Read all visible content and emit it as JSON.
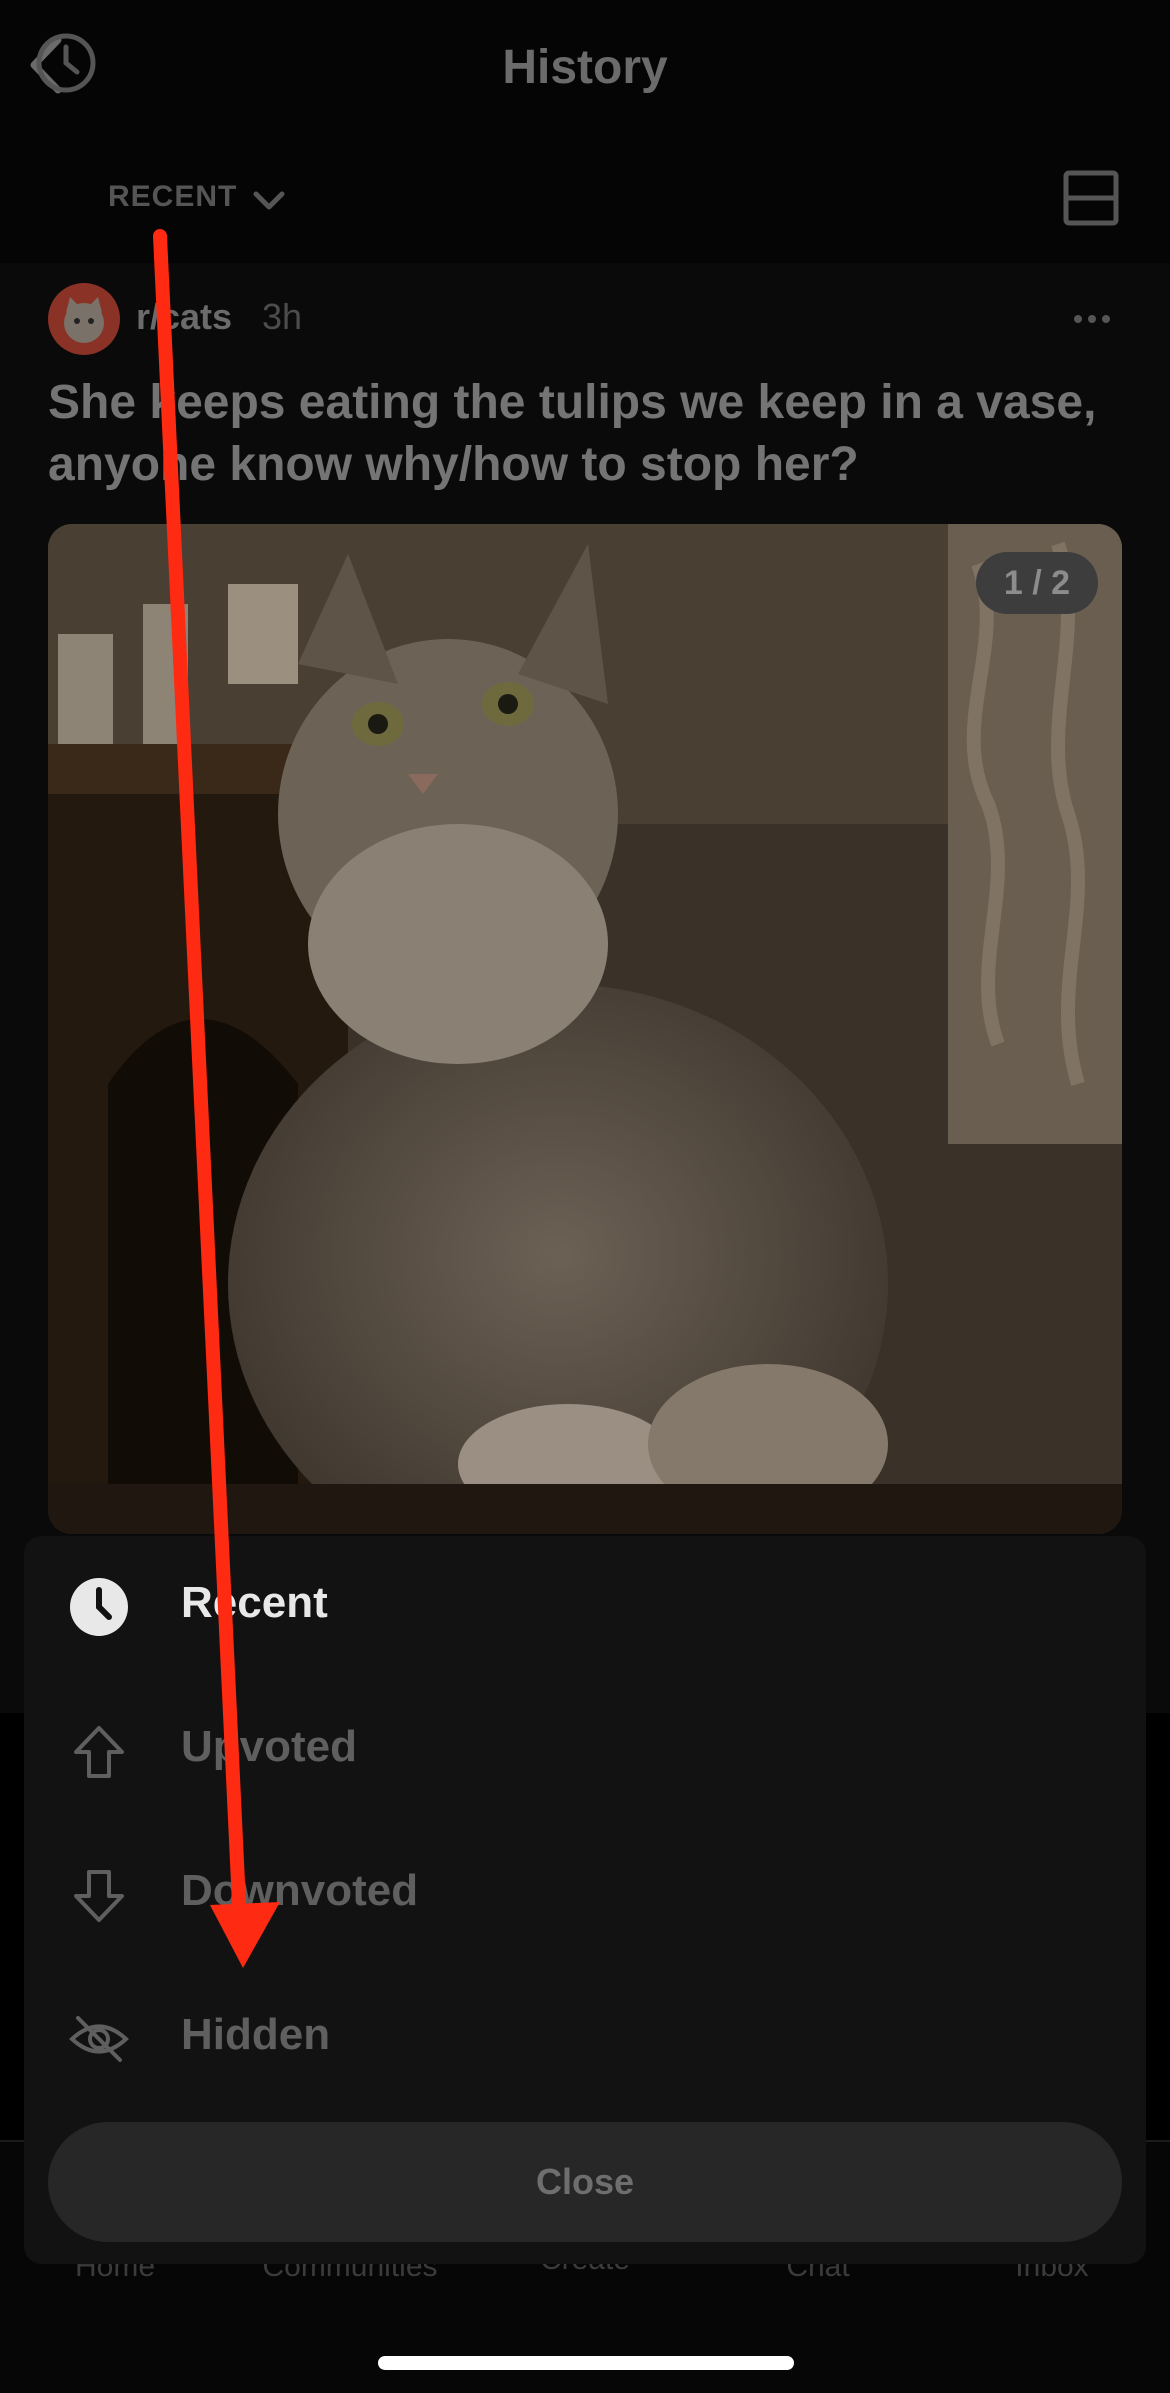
{
  "header": {
    "title": "History",
    "back_icon": "chevron-left-icon"
  },
  "sort_bar": {
    "label": "RECENT",
    "icon": "clock-icon",
    "chevron": "chevron-down-icon",
    "layout_icon": "card-layout-icon"
  },
  "post": {
    "subreddit": "r/cats",
    "age": "3h",
    "title": "She keeps eating the tulips we keep in a vase, anyone know why/how to stop her?",
    "image_counter": "1 / 2",
    "more_icon": "more-horizontal-icon"
  },
  "tabs": [
    {
      "label": "Home"
    },
    {
      "label": "Communities"
    },
    {
      "label": "Create"
    },
    {
      "label": "Chat"
    },
    {
      "label": "Inbox"
    }
  ],
  "sheet": {
    "options": [
      {
        "label": "Recent",
        "icon": "clock-filled-icon",
        "selected": true
      },
      {
        "label": "Upvoted",
        "icon": "upvote-icon",
        "selected": false
      },
      {
        "label": "Downvoted",
        "icon": "downvote-icon",
        "selected": false
      },
      {
        "label": "Hidden",
        "icon": "eye-off-icon",
        "selected": false
      }
    ],
    "close_label": "Close"
  },
  "colors": {
    "annotation_arrow": "#ff2a12",
    "sheet_bg": "#121212",
    "app_bg": "#000000"
  }
}
